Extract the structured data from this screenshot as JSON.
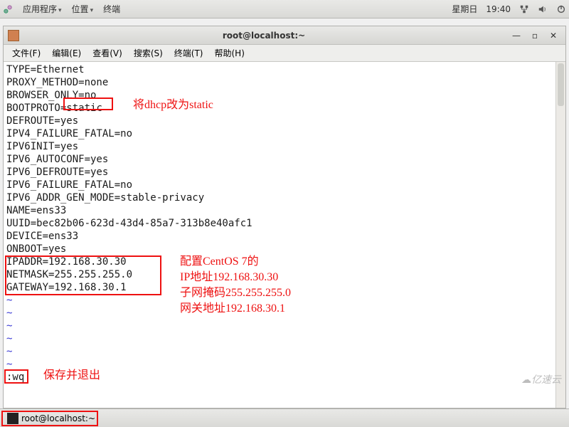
{
  "topbar": {
    "menu_apps": "应用程序",
    "menu_places": "位置",
    "menu_terminal": "终端",
    "day": "星期日",
    "time": "19:40"
  },
  "window": {
    "title": "root@localhost:~"
  },
  "menubar": {
    "file": "文件(F)",
    "edit": "编辑(E)",
    "view": "查看(V)",
    "search": "搜索(S)",
    "terminal": "终端(T)",
    "help": "帮助(H)"
  },
  "term": {
    "l01": "TYPE=Ethernet",
    "l02": "PROXY_METHOD=none",
    "l03": "BROWSER_ONLY=no",
    "l04a": "BOOTPROTO=",
    "l04b": "static",
    "l05": "DEFROUTE=yes",
    "l06": "IPV4_FAILURE_FATAL=no",
    "l07": "IPV6INIT=yes",
    "l08": "IPV6_AUTOCONF=yes",
    "l09": "IPV6_DEFROUTE=yes",
    "l10": "IPV6_FAILURE_FATAL=no",
    "l11": "IPV6_ADDR_GEN_MODE=stable-privacy",
    "l12": "NAME=ens33",
    "l13": "UUID=bec82b06-623d-43d4-85a7-313b8e40afc1",
    "l14": "DEVICE=ens33",
    "l15": "ONBOOT=yes",
    "l16": "IPADDR=192.168.30.30",
    "l17": "NETMASK=255.255.255.0",
    "l18": "GATEWAY=192.168.30.1",
    "tilde": "~",
    "cmd": ":wq"
  },
  "annot": {
    "a1": "将dhcp改为static",
    "a2_l1": "配置CentOS 7的",
    "a2_l2": "IP地址192.168.30.30",
    "a2_l3": "子网掩码255.255.255.0",
    "a2_l4": "网关地址192.168.30.1",
    "a3": "保存并退出"
  },
  "taskbar": {
    "task1": "root@localhost:~"
  },
  "watermark": "亿速云"
}
